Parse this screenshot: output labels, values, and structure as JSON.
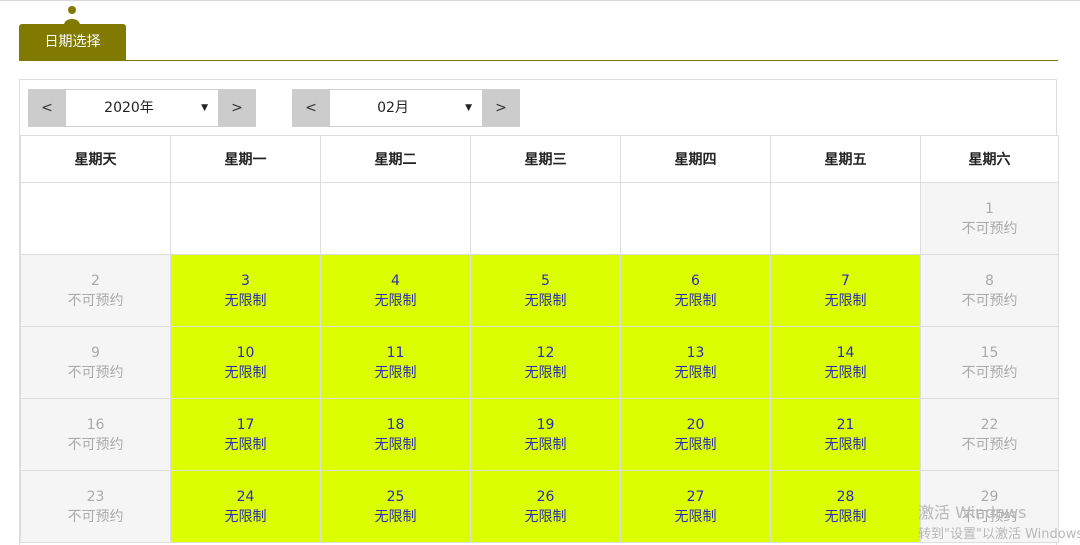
{
  "tab": {
    "label": "日期选择"
  },
  "year_nav": {
    "prev": "<",
    "value": "2020年",
    "next": ">"
  },
  "month_nav": {
    "prev": "<",
    "value": "02月",
    "next": ">"
  },
  "weekdays": [
    "星期天",
    "星期一",
    "星期二",
    "星期三",
    "星期四",
    "星期五",
    "星期六"
  ],
  "weeks": [
    [
      {
        "day": "",
        "status": ""
      },
      {
        "day": "",
        "status": ""
      },
      {
        "day": "",
        "status": ""
      },
      {
        "day": "",
        "status": ""
      },
      {
        "day": "",
        "status": ""
      },
      {
        "day": "",
        "status": ""
      },
      {
        "day": "1",
        "status": "不可预约"
      }
    ],
    [
      {
        "day": "2",
        "status": "不可预约"
      },
      {
        "day": "3",
        "status": "无限制"
      },
      {
        "day": "4",
        "status": "无限制"
      },
      {
        "day": "5",
        "status": "无限制"
      },
      {
        "day": "6",
        "status": "无限制"
      },
      {
        "day": "7",
        "status": "无限制"
      },
      {
        "day": "8",
        "status": "不可预约"
      }
    ],
    [
      {
        "day": "9",
        "status": "不可预约"
      },
      {
        "day": "10",
        "status": "无限制"
      },
      {
        "day": "11",
        "status": "无限制"
      },
      {
        "day": "12",
        "status": "无限制"
      },
      {
        "day": "13",
        "status": "无限制"
      },
      {
        "day": "14",
        "status": "无限制"
      },
      {
        "day": "15",
        "status": "不可预约"
      }
    ],
    [
      {
        "day": "16",
        "status": "不可预约"
      },
      {
        "day": "17",
        "status": "无限制"
      },
      {
        "day": "18",
        "status": "无限制"
      },
      {
        "day": "19",
        "status": "无限制"
      },
      {
        "day": "20",
        "status": "无限制"
      },
      {
        "day": "21",
        "status": "无限制"
      },
      {
        "day": "22",
        "status": "不可预约"
      }
    ],
    [
      {
        "day": "23",
        "status": "不可预约"
      },
      {
        "day": "24",
        "status": "无限制"
      },
      {
        "day": "25",
        "status": "无限制"
      },
      {
        "day": "26",
        "status": "无限制"
      },
      {
        "day": "27",
        "status": "无限制"
      },
      {
        "day": "28",
        "status": "无限制"
      },
      {
        "day": "29",
        "status": "不可预约"
      }
    ]
  ],
  "watermark": {
    "line1": "激活 Windows",
    "line2": "转到\"设置\"以激活 Windows"
  },
  "colors": {
    "accent": "#817a00",
    "available": "#dbff00",
    "available_text": "#2b2bb8",
    "blocked_bg": "#f5f5f5",
    "blocked_text": "#aaaaaa"
  }
}
